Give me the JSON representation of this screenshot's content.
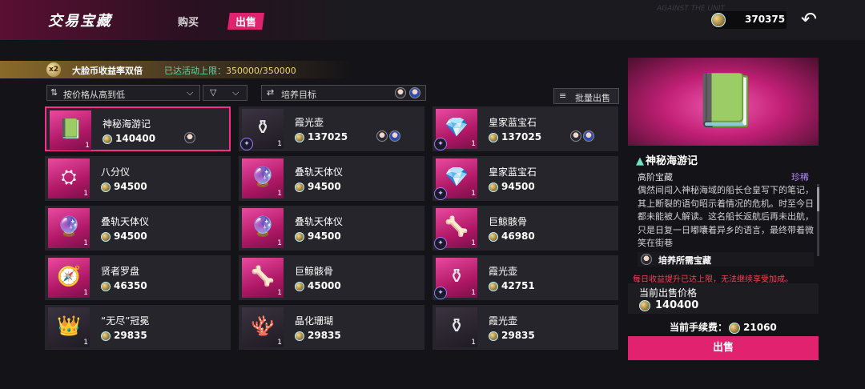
{
  "header": {
    "title": "交易宝藏",
    "tabs": [
      {
        "label": "购买",
        "active": false
      },
      {
        "label": "出售",
        "active": true
      }
    ],
    "watermark": "AGAINST THE UNIT",
    "currency": {
      "value": "370375",
      "icon": "coin-icon"
    },
    "back_icon": "back-arrow-icon"
  },
  "banner": {
    "badge": "x2",
    "text": "大脸币收益率双倍",
    "limit_label": "已达活动上限：",
    "limit_value": "350000/350000"
  },
  "controls": {
    "sort_label": "按价格从高到低",
    "target_label": "培养目标",
    "batch_sell": "批量出售"
  },
  "items": [
    {
      "name": "神秘海游记",
      "price": "140400",
      "qty": "1",
      "icon": "book-icon",
      "glyph": "📗",
      "avatar": true,
      "selected": true,
      "thumb": "pink",
      "badge": false
    },
    {
      "name": "霞光壶",
      "price": "137025",
      "qty": "1",
      "icon": "teapot-icon",
      "glyph": "⚱",
      "avatar": true,
      "selected": false,
      "thumb": "dark",
      "badge": true
    },
    {
      "name": "皇家蓝宝石",
      "price": "137025",
      "qty": "1",
      "icon": "necklace-icon",
      "glyph": "💎",
      "avatar": true,
      "selected": false,
      "thumb": "pink",
      "badge": true
    },
    {
      "name": "八分仪",
      "price": "94500",
      "qty": "1",
      "icon": "octant-icon",
      "glyph": "⛭",
      "avatar": false,
      "selected": false,
      "thumb": "pink",
      "badge": false
    },
    {
      "name": "叠轨天体仪",
      "price": "94500",
      "qty": "1",
      "icon": "orrery-icon",
      "glyph": "🔮",
      "avatar": false,
      "selected": false,
      "thumb": "pink",
      "badge": false
    },
    {
      "name": "皇家蓝宝石",
      "price": "94500",
      "qty": "1",
      "icon": "necklace-icon",
      "glyph": "💎",
      "avatar": false,
      "selected": false,
      "thumb": "pink",
      "badge": true
    },
    {
      "name": "叠轨天体仪",
      "price": "94500",
      "qty": "1",
      "icon": "orrery-icon",
      "glyph": "🔮",
      "avatar": false,
      "selected": false,
      "thumb": "pink",
      "badge": false
    },
    {
      "name": "叠轨天体仪",
      "price": "94500",
      "qty": "1",
      "icon": "orrery-icon",
      "glyph": "🔮",
      "avatar": false,
      "selected": false,
      "thumb": "pink",
      "badge": false
    },
    {
      "name": "巨鲸骸骨",
      "price": "46980",
      "qty": "1",
      "icon": "bone-icon",
      "glyph": "🦴",
      "avatar": false,
      "selected": false,
      "thumb": "pink",
      "badge": true
    },
    {
      "name": "贤者罗盘",
      "price": "46350",
      "qty": "1",
      "icon": "compass-icon",
      "glyph": "🧭",
      "avatar": false,
      "selected": false,
      "thumb": "pink",
      "badge": false
    },
    {
      "name": "巨鲸骸骨",
      "price": "45000",
      "qty": "1",
      "icon": "bone-icon",
      "glyph": "🦴",
      "avatar": false,
      "selected": false,
      "thumb": "pink",
      "badge": false
    },
    {
      "name": "霞光壶",
      "price": "42751",
      "qty": "1",
      "icon": "teapot-icon",
      "glyph": "⚱",
      "avatar": false,
      "selected": false,
      "thumb": "pink",
      "badge": true
    },
    {
      "name": "“无尽”冠冕",
      "price": "29835",
      "qty": "1",
      "icon": "crown-icon",
      "glyph": "👑",
      "avatar": false,
      "selected": false,
      "thumb": "dark",
      "badge": false
    },
    {
      "name": "晶化珊瑚",
      "price": "29835",
      "qty": "1",
      "icon": "coral-icon",
      "glyph": "🪸",
      "avatar": false,
      "selected": false,
      "thumb": "dark",
      "badge": false
    },
    {
      "name": "霞光壶",
      "price": "29835",
      "qty": "1",
      "icon": "teapot-icon",
      "glyph": "⚱",
      "avatar": false,
      "selected": false,
      "thumb": "dark",
      "badge": false
    }
  ],
  "detail": {
    "name": "神秘海游记",
    "name_icon": "boot-icon",
    "type": "高阶宝藏",
    "rarity": "珍稀",
    "description": "偶然间闯入神秘海域的船长仓皇写下的笔记，其上断裂的语句昭示着情况的危机。时至今日都未能被人解读。这名船长返航后再未出航，只是日复一日嘟囔着异乡的语言，最终带着微笑在街巷",
    "train_label": "培养所需宝藏",
    "warning": "每日收益提升已达上限，无法继续享受加成。",
    "price_label": "当前出售价格",
    "price_value": "140400",
    "fee_label": "当前手续费：",
    "fee_value": "21060",
    "sell_button": "出售"
  },
  "colors": {
    "accent": "#e0226f",
    "warning": "#ff3b5a",
    "rarity": "#b58cff",
    "limit": "#5fd7a6"
  }
}
